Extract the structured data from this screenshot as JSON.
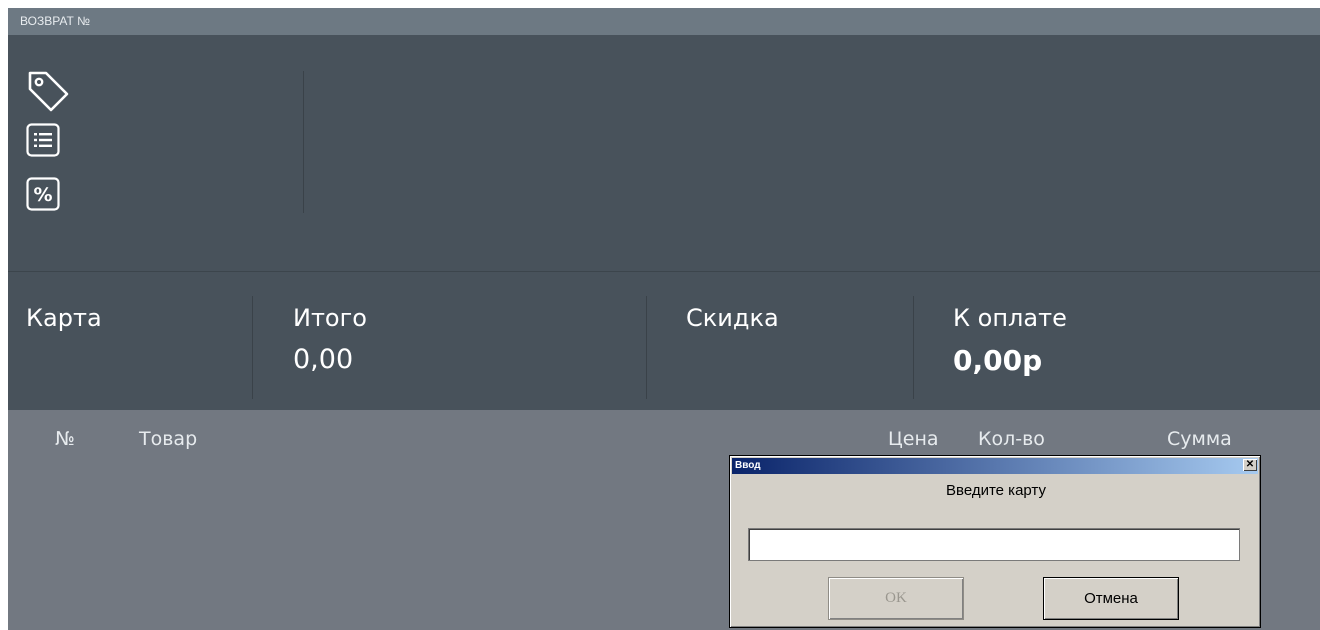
{
  "window": {
    "title": "ВОЗВРАТ №"
  },
  "toolbar": {
    "icons": [
      "price-tag-icon",
      "list-icon",
      "percent-icon"
    ],
    "percent_symbol": "%"
  },
  "totals": {
    "card_label": "Карта",
    "total_label": "Итого",
    "total_value": "0,00",
    "discount_label": "Скидка",
    "due_label": "К оплате",
    "due_value": "0,00р"
  },
  "list": {
    "columns": [
      "№",
      "Товар",
      "Цена",
      "Кол-во",
      "Сумма"
    ]
  },
  "dialog": {
    "title": "Ввод",
    "close_label": "✕",
    "prompt": "Введите карту",
    "input_value": "",
    "ok_label": "OK",
    "cancel_label": "Отмена"
  },
  "colors": {
    "panel": "#48525b",
    "list_background": "#727881",
    "dialog_face": "#d4d0c8",
    "dialog_title_start": "#0a246a",
    "dialog_title_end": "#a6caf0"
  }
}
